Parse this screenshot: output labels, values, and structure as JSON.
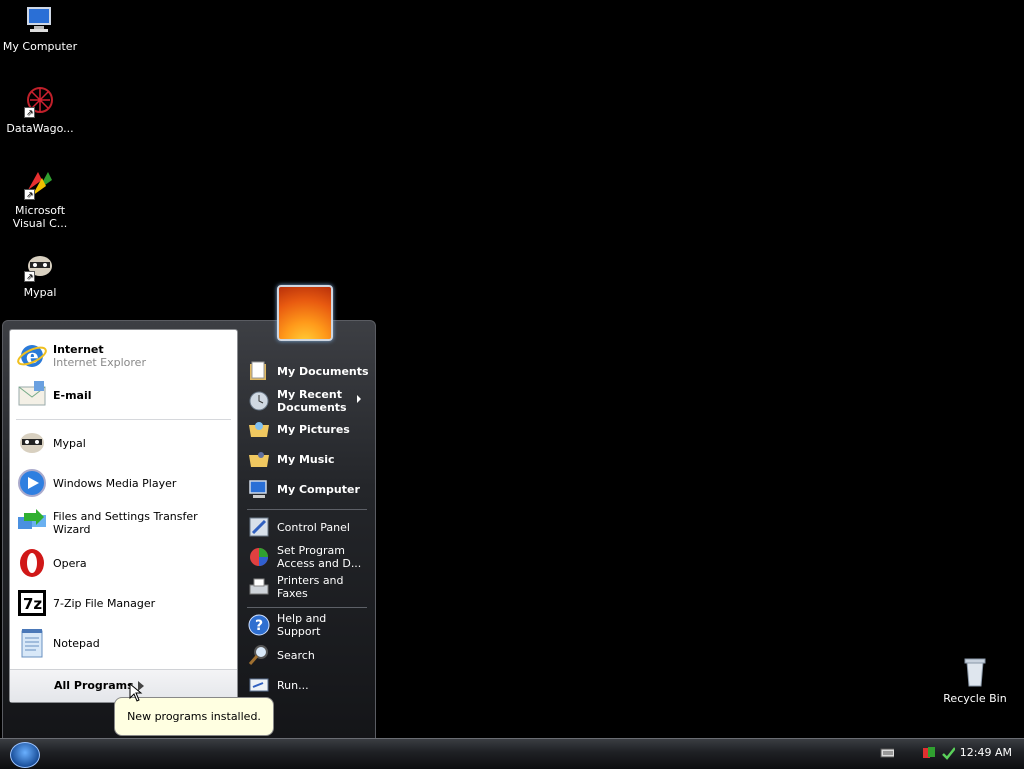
{
  "desktop": {
    "icons": [
      {
        "label": "My Computer"
      },
      {
        "label": "DataWago..."
      },
      {
        "label": "Microsoft Visual C..."
      },
      {
        "label": "Mypal"
      },
      {
        "label": "Recycle Bin"
      }
    ]
  },
  "start_menu": {
    "pinned": [
      {
        "title": "Internet",
        "subtitle": "Internet Explorer"
      },
      {
        "title": "E-mail"
      }
    ],
    "recent": [
      {
        "label": "Mypal"
      },
      {
        "label": "Windows Media Player"
      },
      {
        "label": "Files and Settings Transfer Wizard"
      },
      {
        "label": "Opera"
      },
      {
        "label": "7-Zip File Manager"
      },
      {
        "label": "Notepad"
      }
    ],
    "all_programs": "All Programs",
    "right": [
      {
        "label": "My Documents"
      },
      {
        "label": "My Recent Documents"
      },
      {
        "label": "My Pictures"
      },
      {
        "label": "My Music"
      },
      {
        "label": "My Computer"
      },
      {
        "label": "Control Panel"
      },
      {
        "label": "Set Program Access and D..."
      },
      {
        "label": "Printers and Faxes"
      },
      {
        "label": "Help and Support"
      },
      {
        "label": "Search"
      },
      {
        "label": "Run..."
      }
    ]
  },
  "balloon": {
    "text": "New programs installed."
  },
  "taskbar": {
    "clock": "12:49 AM"
  },
  "colors": {
    "balloon_bg": "#ffffe1",
    "menu_dark": "#24262a"
  }
}
